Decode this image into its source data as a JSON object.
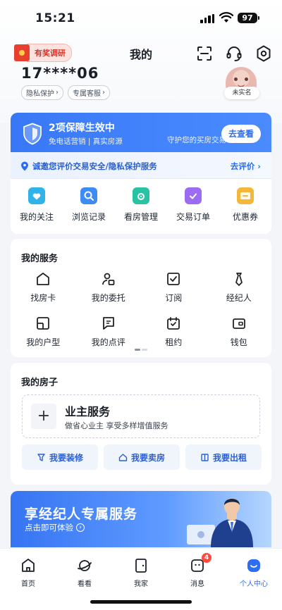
{
  "status_bar": {
    "time": "15:21",
    "battery": "97"
  },
  "header": {
    "survey_label": "有奖调研",
    "title": "我的",
    "user_id": "17****06",
    "tags": [
      "隐私保护",
      "专属客服"
    ],
    "verify_status": "未实名",
    "icons": [
      "scan-icon",
      "headset-icon",
      "settings-icon"
    ]
  },
  "guarantee": {
    "title": "2项保障生效中",
    "subtitle": "免电话营销 | 真实房源",
    "note": "守护您的买房交易",
    "button": "去查看"
  },
  "invite": {
    "text": "诚邀您评价交易安全/隐私保护服务",
    "link": "去评价"
  },
  "quick_actions": [
    {
      "label": "我的关注",
      "icon": "heart-icon",
      "color": "#2fb3e8"
    },
    {
      "label": "浏览记录",
      "icon": "history-icon",
      "color": "#3d8bf5"
    },
    {
      "label": "看房管理",
      "icon": "house-view-icon",
      "color": "#28c3a2"
    },
    {
      "label": "交易订单",
      "icon": "order-icon",
      "color": "#9b6cf2"
    },
    {
      "label": "优惠券",
      "icon": "coupon-icon",
      "color": "#f5b73a"
    }
  ],
  "services": {
    "title": "我的服务",
    "items": [
      {
        "label": "找房卡",
        "icon": "home-card-icon"
      },
      {
        "label": "我的委托",
        "icon": "entrust-icon"
      },
      {
        "label": "订阅",
        "icon": "subscribe-icon"
      },
      {
        "label": "经纪人",
        "icon": "agent-tie-icon"
      },
      {
        "label": "我的户型",
        "icon": "floorplan-icon"
      },
      {
        "label": "我的点评",
        "icon": "review-icon"
      },
      {
        "label": "租约",
        "icon": "lease-icon"
      },
      {
        "label": "钱包",
        "icon": "wallet-icon"
      }
    ]
  },
  "house": {
    "title": "我的房子",
    "owner_title": "业主服务",
    "owner_sub": "做省心业主 享受多样增值服务",
    "actions": [
      {
        "label": "我要装修",
        "icon": "renovate-icon"
      },
      {
        "label": "我要卖房",
        "icon": "sell-house-icon"
      },
      {
        "label": "我要出租",
        "icon": "rent-out-icon"
      }
    ]
  },
  "banner": {
    "title": "享经纪人专属服务",
    "subtitle": "点击即可体验"
  },
  "bottom_nav": [
    {
      "label": "首页",
      "icon": "home-icon"
    },
    {
      "label": "看看",
      "icon": "planet-icon"
    },
    {
      "label": "我家",
      "icon": "my-home-icon"
    },
    {
      "label": "消息",
      "icon": "message-icon",
      "badge": "4"
    },
    {
      "label": "个人中心",
      "icon": "profile-icon",
      "active": true
    }
  ],
  "accent_color": "#2c6df2"
}
